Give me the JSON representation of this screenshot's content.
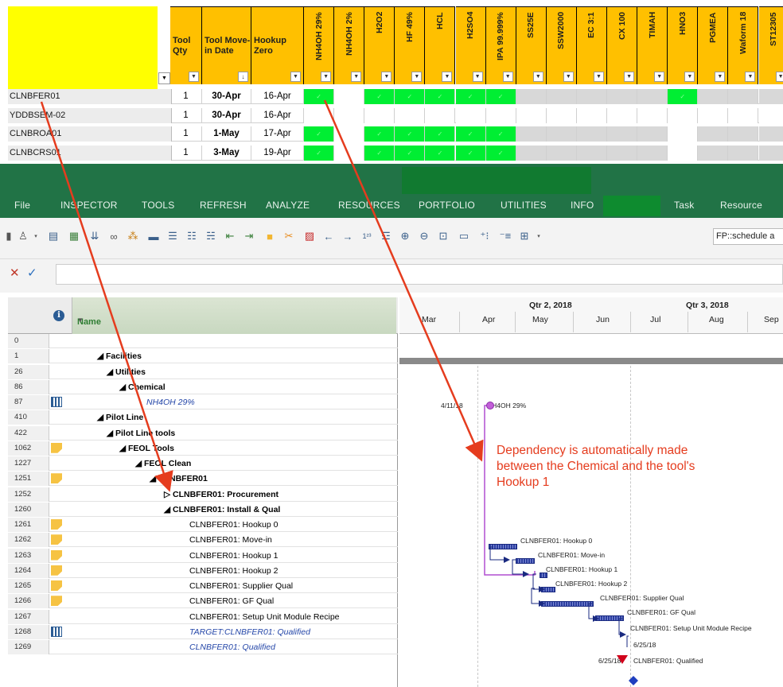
{
  "sheet": {
    "headers_text": [
      {
        "key": "qty",
        "label": "Tool Qty"
      },
      {
        "key": "move",
        "label": "Tool Move-in Date"
      },
      {
        "key": "hook",
        "label": "Hookup Zero"
      }
    ],
    "headers_vertical": [
      "NH4OH 29%",
      "NH4OH 2%",
      "H2O2",
      "HF 49%",
      "HCL",
      "H2SO4",
      "IPA 99.999%",
      "SS25E",
      "SSW2000",
      "EC 3:1",
      "CX 100",
      "TIMAH",
      "HNO3",
      "PGMEA",
      "Waform 18",
      "ST12305"
    ],
    "rows": [
      {
        "name": "CLNBFER01",
        "qty": "1",
        "move": "30-Apr",
        "hook": "16-Apr"
      },
      {
        "name": "YDDBSEM-02",
        "qty": "1",
        "move": "30-Apr",
        "hook": "16-Apr"
      },
      {
        "name": "CLNBROA01",
        "qty": "1",
        "move": "1-May",
        "hook": "17-Apr"
      },
      {
        "name": "CLNBCRS01",
        "qty": "1",
        "move": "3-May",
        "hook": "19-Apr"
      }
    ],
    "check": "✓"
  },
  "ribbon": {
    "menu": [
      "File",
      "INSPECTOR",
      "TOOLS",
      "REFRESH",
      "ANALYZE",
      "RESOURCES",
      "PORTFOLIO",
      "UTILITIES",
      "INFO",
      "Task",
      "Resource"
    ]
  },
  "toolbar": {
    "combo_value": "FP::schedule a"
  },
  "grid": {
    "header_name": "Name",
    "info_glyph": "i",
    "rows": [
      {
        "num": "0",
        "text": "",
        "level": 0
      },
      {
        "num": "1",
        "text": "◢ Facilities",
        "level": 1,
        "bold": true
      },
      {
        "num": "26",
        "text": "◢ Utilities",
        "level": 2,
        "bold": true
      },
      {
        "num": "86",
        "text": "◢ Chemical",
        "level": 3,
        "bold": true
      },
      {
        "num": "87",
        "text": "NH4OH 29%",
        "level": 4,
        "link": true,
        "ind": "cal"
      },
      {
        "num": "410",
        "text": "◢ Pilot Line",
        "level": 1,
        "bold": true
      },
      {
        "num": "422",
        "text": "◢ Pilot Line tools",
        "level": 2,
        "bold": true
      },
      {
        "num": "1062",
        "text": "◢ FEOL Tools",
        "level": 3,
        "bold": true,
        "ind": "note"
      },
      {
        "num": "1227",
        "text": "◢ FEOL Clean",
        "level": 4,
        "bold": true
      },
      {
        "num": "1251",
        "text": "◢ CLNBFER01",
        "level": 5,
        "bold": true,
        "ind": "note"
      },
      {
        "num": "1252",
        "text": "▷ CLNBFER01: Procurement",
        "level": 6,
        "bold": true
      },
      {
        "num": "1260",
        "text": "◢ CLNBFER01: Install & Qual",
        "level": 6,
        "bold": true
      },
      {
        "num": "1261",
        "text": "CLNBFER01: Hookup 0",
        "level": 7,
        "ind": "note"
      },
      {
        "num": "1262",
        "text": "CLNBFER01: Move-in",
        "level": 7,
        "ind": "note"
      },
      {
        "num": "1263",
        "text": "CLNBFER01: Hookup 1",
        "level": 7,
        "ind": "note"
      },
      {
        "num": "1264",
        "text": "CLNBFER01: Hookup 2",
        "level": 7,
        "ind": "note"
      },
      {
        "num": "1265",
        "text": "CLNBFER01: Supplier Qual",
        "level": 7,
        "ind": "note"
      },
      {
        "num": "1266",
        "text": "CLNBFER01: GF Qual",
        "level": 7,
        "ind": "note"
      },
      {
        "num": "1267",
        "text": "CLNBFER01: Setup Unit Module Recipe",
        "level": 7
      },
      {
        "num": "1268",
        "text": "TARGET:CLNBFER01: Qualified",
        "level": 7,
        "link": true,
        "ind": "cal"
      },
      {
        "num": "1269",
        "text": "CLNBFER01: Qualified",
        "level": 7,
        "link": true
      }
    ]
  },
  "gantt": {
    "quarters": [
      "Qtr 2, 2018",
      "Qtr 3, 2018"
    ],
    "months": [
      "Mar",
      "Apr",
      "May",
      "Jun",
      "Jul",
      "Aug",
      "Sep"
    ],
    "milestone_date": "4/11/18",
    "milestone_label": "NH4OH 29%",
    "tasks": [
      "CLNBFER01: Hookup 0",
      "CLNBFER01: Move-in",
      "CLNBFER01: Hookup 1",
      "CLNBFER01: Hookup 2",
      "CLNBFER01: Supplier Qual",
      "CLNBFER01: GF Qual",
      "CLNBFER01: Setup Unit Module Recipe"
    ],
    "target_date": "6/25/18",
    "qualified_date": "6/25/18",
    "qualified_label": "CLNBFER01: Qualified",
    "annotation": "Dependency is automatically made between the Chemical and the tool's Hookup 1"
  },
  "colors": {
    "ribbon_green": "#217346",
    "header_orange": "#ffc000",
    "check_green": "#00ee33",
    "arrow_red": "#e53c1e",
    "dependency_purple": "#b04fd0"
  }
}
